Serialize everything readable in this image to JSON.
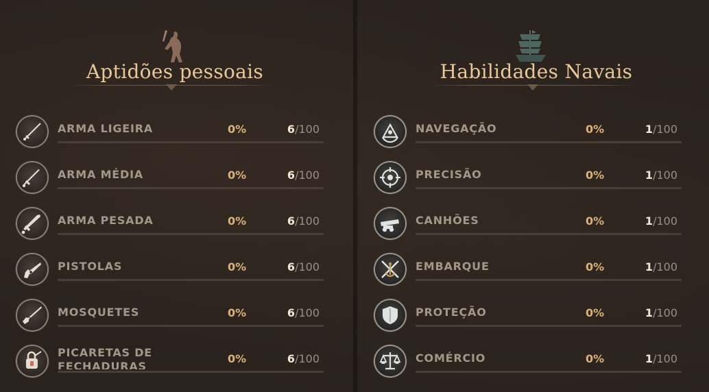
{
  "personal": {
    "title": "Aptidões pessoais",
    "emblem": "swordsman-emblem-icon",
    "skills": [
      {
        "icon": "light-sword-icon",
        "label": "ARMA LIGEIRA",
        "percent": "0%",
        "current": "6",
        "max": "/100",
        "progress": 0
      },
      {
        "icon": "medium-sword-icon",
        "label": "ARMA MÉDIA",
        "percent": "0%",
        "current": "6",
        "max": "/100",
        "progress": 0
      },
      {
        "icon": "heavy-sword-icon",
        "label": "ARMA PESADA",
        "percent": "0%",
        "current": "6",
        "max": "/100",
        "progress": 0
      },
      {
        "icon": "pistol-icon",
        "label": "PISTOLAS",
        "percent": "0%",
        "current": "6",
        "max": "/100",
        "progress": 0
      },
      {
        "icon": "musket-icon",
        "label": "MOSQUETES",
        "percent": "0%",
        "current": "6",
        "max": "/100",
        "progress": 0
      },
      {
        "icon": "lockpick-icon",
        "label": "PICARETAS DE FECHADURAS",
        "percent": "0%",
        "current": "6",
        "max": "/100",
        "progress": 0
      }
    ]
  },
  "naval": {
    "title": "Habilidades Navais",
    "emblem": "ship-emblem-icon",
    "skills": [
      {
        "icon": "sextant-icon",
        "label": "NAVEGAÇÃO",
        "percent": "0%",
        "current": "1",
        "max": "/100",
        "progress": 0
      },
      {
        "icon": "crosshair-icon",
        "label": "PRECISÃO",
        "percent": "0%",
        "current": "1",
        "max": "/100",
        "progress": 0
      },
      {
        "icon": "cannon-icon",
        "label": "CANHÕES",
        "percent": "0%",
        "current": "1",
        "max": "/100",
        "progress": 0
      },
      {
        "icon": "boarding-icon",
        "label": "EMBARQUE",
        "percent": "0%",
        "current": "1",
        "max": "/100",
        "progress": 0
      },
      {
        "icon": "shield-icon",
        "label": "PROTEÇÃO",
        "percent": "0%",
        "current": "1",
        "max": "/100",
        "progress": 0
      },
      {
        "icon": "scales-icon",
        "label": "COMÉRCIO",
        "percent": "0%",
        "current": "1",
        "max": "/100",
        "progress": 0
      }
    ]
  },
  "colors": {
    "title": "#e8c89a",
    "percent": "#d8b27a",
    "label": "#a39789",
    "bar": "#4a3f36"
  }
}
